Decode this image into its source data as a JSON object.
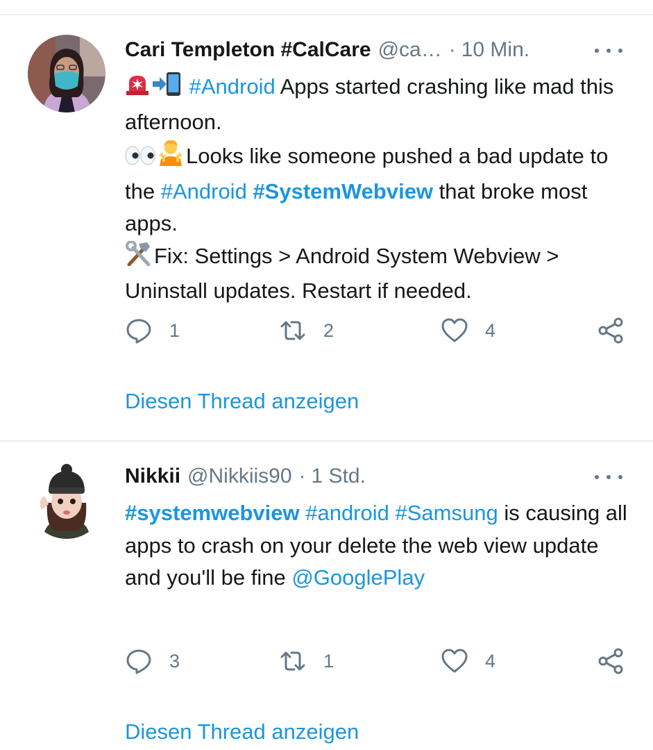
{
  "tweets": [
    {
      "author": {
        "display_name": "Cari Templeton #CalCare",
        "handle": "@ca…",
        "avatar_icon": "avatar-woman-with-face-mask"
      },
      "time": "10 Min.",
      "separator": "·",
      "body": {
        "line1_emoji": [
          "rotating-light-emoji",
          "incoming-to-phone-emoji"
        ],
        "line1_tag": "#Android",
        "line1_text": " Apps started crashing like mad this afternoon.",
        "line2_emoji": [
          "eyes-emoji",
          "shrugging-person-emoji"
        ],
        "line2_text_a": "Looks like someone pushed a bad update to the ",
        "line2_tag1": "#Android",
        "line2_space": " ",
        "line2_tag2": "#SystemWebview",
        "line2_text_b": " that broke most apps.",
        "line3_emoji": [
          "hammer-and-wrench-emoji"
        ],
        "line3_text": "Fix: Settings > Android System Webview > Uninstall updates. Restart if needed."
      },
      "actions": {
        "replies": "1",
        "retweets": "2",
        "likes": "4"
      },
      "thread_link": "Diesen Thread anzeigen"
    },
    {
      "author": {
        "display_name": "Nikkii",
        "handle": "@Nikkiis90",
        "avatar_icon": "avatar-cartoon-girl-with-beanie"
      },
      "time": "1 Std.",
      "separator": "·",
      "body": {
        "tag1": "#systemwebview",
        "tag2": "#android",
        "tag3": "#Samsung",
        "sp": " ",
        "text": " is causing all apps to crash on your delete the web view update and you'll be fine",
        "mention": "@GooglePlay"
      },
      "actions": {
        "replies": "3",
        "retweets": "1",
        "likes": "4"
      },
      "thread_link": "Diesen Thread anzeigen"
    }
  ],
  "colors": {
    "link": "#1b95e0",
    "text": "#14171a",
    "secondary": "#657786",
    "divider": "#e6ecf0"
  }
}
